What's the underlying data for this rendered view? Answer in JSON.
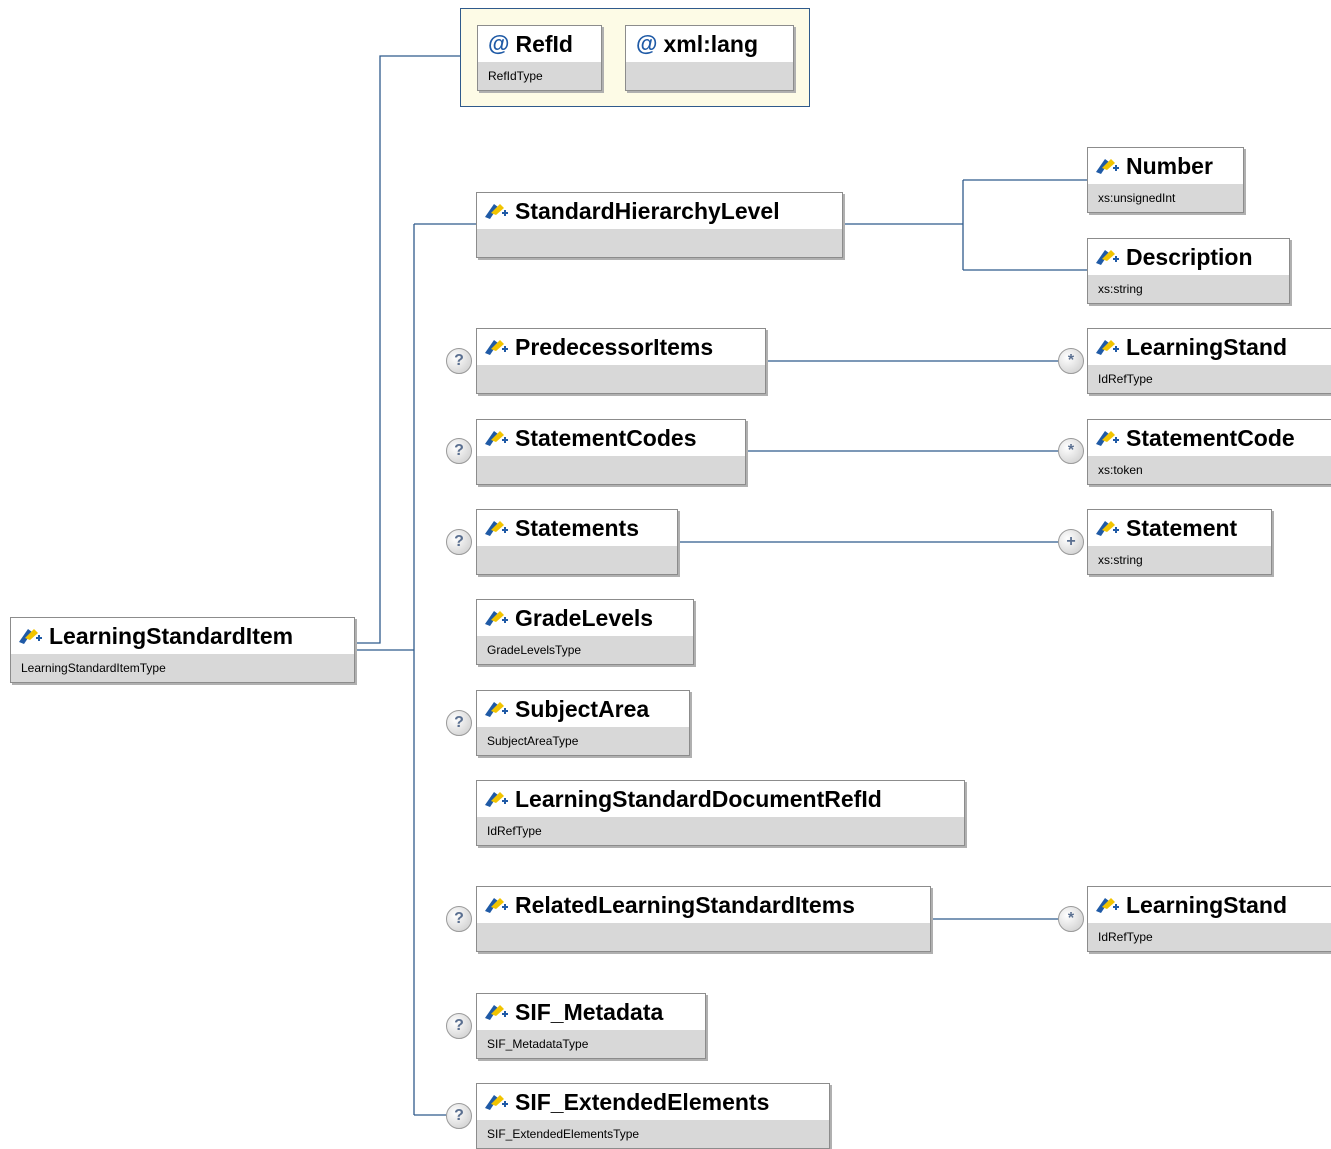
{
  "attributes": [
    {
      "name": "RefId",
      "type": "RefIdType"
    },
    {
      "name": "xml:lang",
      "type": ""
    }
  ],
  "root": {
    "name": "LearningStandardItem",
    "type": "LearningStandardItemType"
  },
  "children": {
    "standard_hierarchy_level": {
      "name": "StandardHierarchyLevel",
      "type": ""
    },
    "predecessor_items": {
      "name": "PredecessorItems",
      "type": ""
    },
    "statement_codes": {
      "name": "StatementCodes",
      "type": ""
    },
    "statements": {
      "name": "Statements",
      "type": ""
    },
    "grade_levels": {
      "name": "GradeLevels",
      "type": "GradeLevelsType"
    },
    "subject_area": {
      "name": "SubjectArea",
      "type": "SubjectAreaType"
    },
    "learning_standard_document_refid": {
      "name": "LearningStandardDocumentRefId",
      "type": "IdRefType"
    },
    "related_learning_standard_items": {
      "name": "RelatedLearningStandardItems",
      "type": ""
    },
    "sif_metadata": {
      "name": "SIF_Metadata",
      "type": "SIF_MetadataType"
    },
    "sif_extended_elements": {
      "name": "SIF_ExtendedElements",
      "type": "SIF_ExtendedElementsType"
    }
  },
  "grandchildren": {
    "number": {
      "name": "Number",
      "type": "xs:unsignedInt"
    },
    "description": {
      "name": "Description",
      "type": "xs:string"
    },
    "predecessor_ref": {
      "name": "LearningStand",
      "type": "IdRefType"
    },
    "statement_code": {
      "name": "StatementCode",
      "type": "xs:token"
    },
    "statement": {
      "name": "Statement",
      "type": "xs:string"
    },
    "related_ref": {
      "name": "LearningStand",
      "type": "IdRefType"
    }
  },
  "occurrence_symbols": {
    "optional": "?",
    "zero_or_more": "*",
    "one_or_more": "+"
  },
  "colors": {
    "connector": "#2f5a8c",
    "badge_text": "#5a6f90",
    "attribute_group_bg": "#fdfbe6",
    "icon_blue": "#1f5aa6",
    "icon_yellow": "#f2c400"
  }
}
